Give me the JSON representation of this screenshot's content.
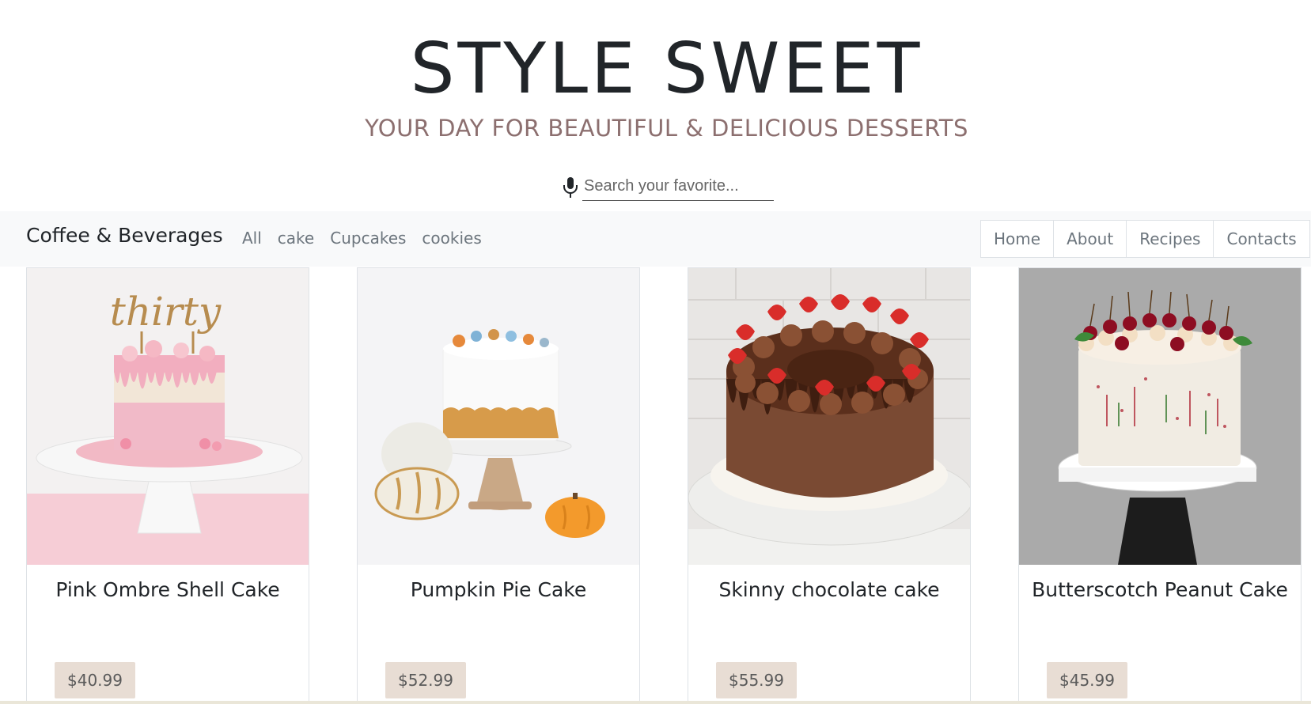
{
  "header": {
    "title": "STYLE SWEET",
    "tagline": "YOUR DAY FOR BEAUTIFUL & DELICIOUS DESSERTS",
    "search_placeholder": "Search your favorite...",
    "mic_icon": "microphone-icon"
  },
  "navbar": {
    "brand": "Coffee & Beverages",
    "filters": [
      "All",
      "cake",
      "Cupcakes",
      "cookies"
    ],
    "links": [
      "Home",
      "About",
      "Recipes",
      "Contacts"
    ]
  },
  "products": [
    {
      "name": "Pink Ombre Shell Cake",
      "price": "$40.99",
      "image": "pink-ombre-cake-image"
    },
    {
      "name": "Pumpkin Pie Cake",
      "price": "$52.99",
      "image": "pumpkin-pie-cake-image"
    },
    {
      "name": "Skinny chocolate cake",
      "price": "$55.99",
      "image": "chocolate-cake-image"
    },
    {
      "name": "Butterscotch Peanut Cake",
      "price": "$45.99",
      "image": "butterscotch-cake-image"
    }
  ],
  "colors": {
    "tagline": "#8c6f6f",
    "navbar_bg": "#f8f9fa",
    "price_badge_bg": "#e8ddd4"
  }
}
